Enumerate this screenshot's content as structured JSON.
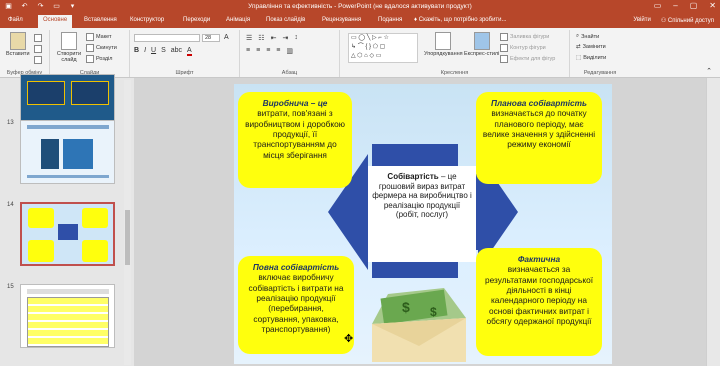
{
  "window": {
    "title": "Управління та ефективність - PowerPoint (не вдалося активувати продукт)"
  },
  "tabs": [
    "Файл",
    "Основне",
    "Вставлення",
    "Конструктор",
    "Переходи",
    "Анімація",
    "Показ слайдів",
    "Рецензування",
    "Подання",
    "Скажіть, що потрібно зробити..."
  ],
  "active_tab": "Основне",
  "account": {
    "user": "Увійти",
    "share": "Спільний доступ"
  },
  "ribbon": {
    "clipboard": {
      "paste": "Вставити",
      "label": "Буфер обміну"
    },
    "slides": {
      "new_slide": "Створити слайд",
      "layout": "Макет",
      "reset": "Скинути",
      "section": "Розділ",
      "label": "Слайди"
    },
    "font": {
      "size": "28",
      "label": "Шрифт"
    },
    "paragraph": {
      "label": "Абзац"
    },
    "drawing": {
      "arrange": "Упорядкування",
      "quick_styles": "Експрес-стилі",
      "fill": "Заливка фігури",
      "outline": "Контур фігури",
      "effects": "Ефекти для фігур",
      "label": "Креслення"
    },
    "editing": {
      "find": "Знайти",
      "replace": "Замінити",
      "select": "Виділити",
      "label": "Редагування"
    }
  },
  "slides_panel": {
    "numbers": [
      "13",
      "14",
      "15"
    ],
    "selected": "14"
  },
  "slide": {
    "top_left": {
      "title": "Виробнича – це",
      "body": "витрати, пов'язані з виробництвом і доробкою продукції, її транспортуванням до місця зберігання"
    },
    "top_right": {
      "title": "Планова собівартість",
      "body": "визначається до початку планового періоду, має велике значення у здійсненні режиму економії"
    },
    "center": {
      "title": "Собівартість",
      "body": "– це грошовий вираз витрат фермера на виробництво і реалізацію продукції (робіт, послуг)"
    },
    "bottom_left": {
      "title": "Повна собівартість",
      "body": "включає виробничу собівартість і витрати на реалізацію продукції (перебирання, сортування, упаковка, транспортування)"
    },
    "bottom_right": {
      "title": "Фактична",
      "body": "визначається за результатами господарської діяльності в кінці календарного періоду на основі фактичних витрат і обсягу одержаної продукції"
    }
  },
  "colors": {
    "accent": "#b7472a",
    "box_fill": "#ffff0d",
    "arrow_fill": "#2f4fa8",
    "heading_blue": "#1f3763"
  }
}
